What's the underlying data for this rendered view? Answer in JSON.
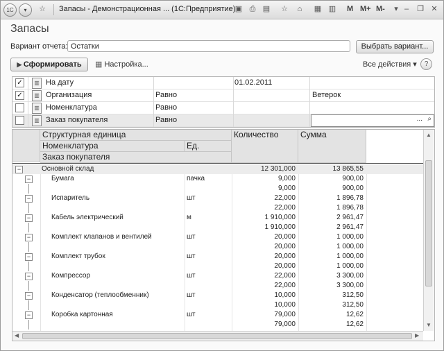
{
  "window": {
    "title": "Запасы - Демонстрационная ... (1С:Предприятие)",
    "app_icon": "1С",
    "mem_labels": [
      "M",
      "M+",
      "M-"
    ]
  },
  "form": {
    "title": "Запасы"
  },
  "variant": {
    "label": "Вариант отчета:",
    "value": "Остатки",
    "choose_button": "Выбрать вариант..."
  },
  "toolbar": {
    "generate": "Сформировать",
    "settings": "Настройка...",
    "all_actions": "Все действия",
    "help": "?"
  },
  "filters": [
    {
      "checked": true,
      "field": "На дату",
      "condition": "",
      "value": "01.02.2011"
    },
    {
      "checked": true,
      "field": "Организация",
      "condition": "Равно",
      "value": "Ветерок"
    },
    {
      "checked": false,
      "field": "Номенклатура",
      "condition": "Равно",
      "value": ""
    },
    {
      "checked": false,
      "field": "Заказ покупателя",
      "condition": "Равно",
      "value": ""
    }
  ],
  "grid": {
    "headers": {
      "unit": "Структурная единица",
      "nomen": "Номенклатура",
      "ed": "Ед.",
      "order": "Заказ покупателя",
      "qty": "Количество",
      "sum": "Сумма"
    },
    "group": {
      "name": "Основной склад",
      "qty": "12 301,000",
      "sum": "13 865,55"
    },
    "items": [
      {
        "name": "Бумага",
        "unit": "пачка",
        "qty": "9,000",
        "sum": "900,00"
      },
      {
        "name": "Испаритель",
        "unit": "шт",
        "qty": "22,000",
        "sum": "1 896,78"
      },
      {
        "name": "Кабель электрический",
        "unit": "м",
        "qty": "1 910,000",
        "sum": "2 961,47"
      },
      {
        "name": "Комплект клапанов и вентилей",
        "unit": "шт",
        "qty": "20,000",
        "sum": "1 000,00"
      },
      {
        "name": "Комплект трубок",
        "unit": "шт",
        "qty": "20,000",
        "sum": "1 000,00"
      },
      {
        "name": "Компрессор",
        "unit": "шт",
        "qty": "22,000",
        "sum": "3 300,00"
      },
      {
        "name": "Конденсатор (теплообменник)",
        "unit": "шт",
        "qty": "10,000",
        "sum": "312,50"
      },
      {
        "name": "Коробка картонная",
        "unit": "шт",
        "qty": "79,000",
        "sum": "12,62"
      }
    ]
  }
}
